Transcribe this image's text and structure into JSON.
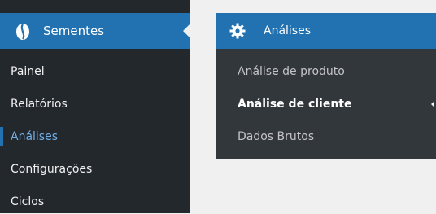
{
  "sidebar": {
    "header": {
      "label": "Sementes",
      "icon": "seed-icon"
    },
    "items": [
      {
        "label": "Painel"
      },
      {
        "label": "Relatórios"
      },
      {
        "label": "Análises",
        "active": true
      },
      {
        "label": "Configurações"
      },
      {
        "label": "Ciclos"
      }
    ]
  },
  "flyout": {
    "header": {
      "label": "Análises",
      "icon": "gear-icon"
    },
    "items": [
      {
        "label": "Análise de produto"
      },
      {
        "label": "Análise de cliente",
        "current": true
      },
      {
        "label": "Dados Brutos"
      }
    ]
  },
  "colors": {
    "accent": "#2271b1",
    "sidebar_bg": "#23282d",
    "submenu_bg": "#32373c",
    "active_text": "#72aee6"
  }
}
